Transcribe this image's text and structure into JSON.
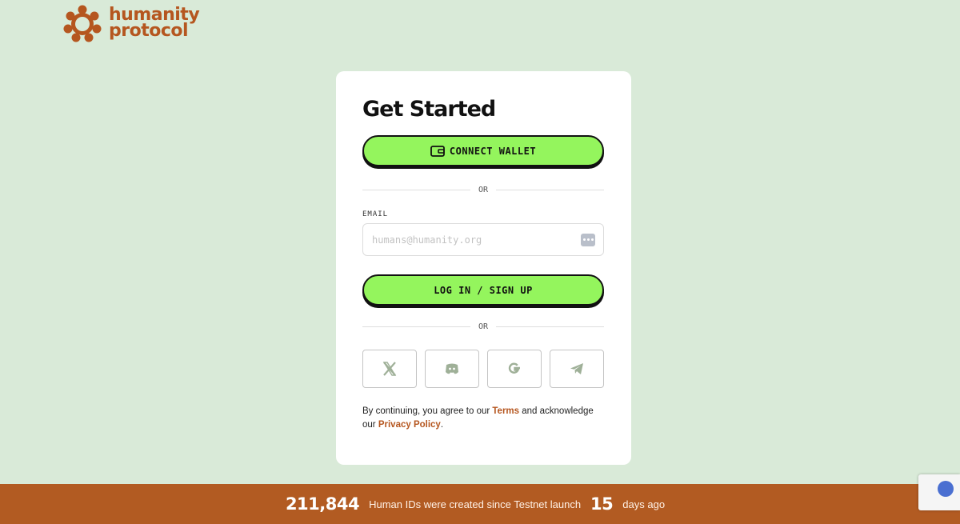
{
  "brand": {
    "line1": "humanity",
    "line2": "protocol",
    "color": "#b5561f"
  },
  "card": {
    "title": "Get Started",
    "connect_wallet_label": "CONNECT WALLET",
    "divider_text": "OR",
    "email_label": "EMAIL",
    "email_placeholder": "humans@humanity.org",
    "email_value": "",
    "login_label": "LOG IN / SIGN UP",
    "divider2_text": "OR",
    "socials": [
      "x-icon",
      "discord-icon",
      "google-icon",
      "telegram-icon"
    ],
    "legal": {
      "part1": "By continuing, you agree to our ",
      "terms": "Terms",
      "part2": " and acknowledge our ",
      "privacy": "Privacy Policy",
      "part3": "."
    }
  },
  "banner": {
    "count": "211,844",
    "text1": "Human IDs were created since Testnet launch",
    "days": "15",
    "text2": "days ago",
    "color": "#b25b22"
  },
  "colors": {
    "background": "#d9ead8",
    "accent_green": "#94f55d"
  }
}
